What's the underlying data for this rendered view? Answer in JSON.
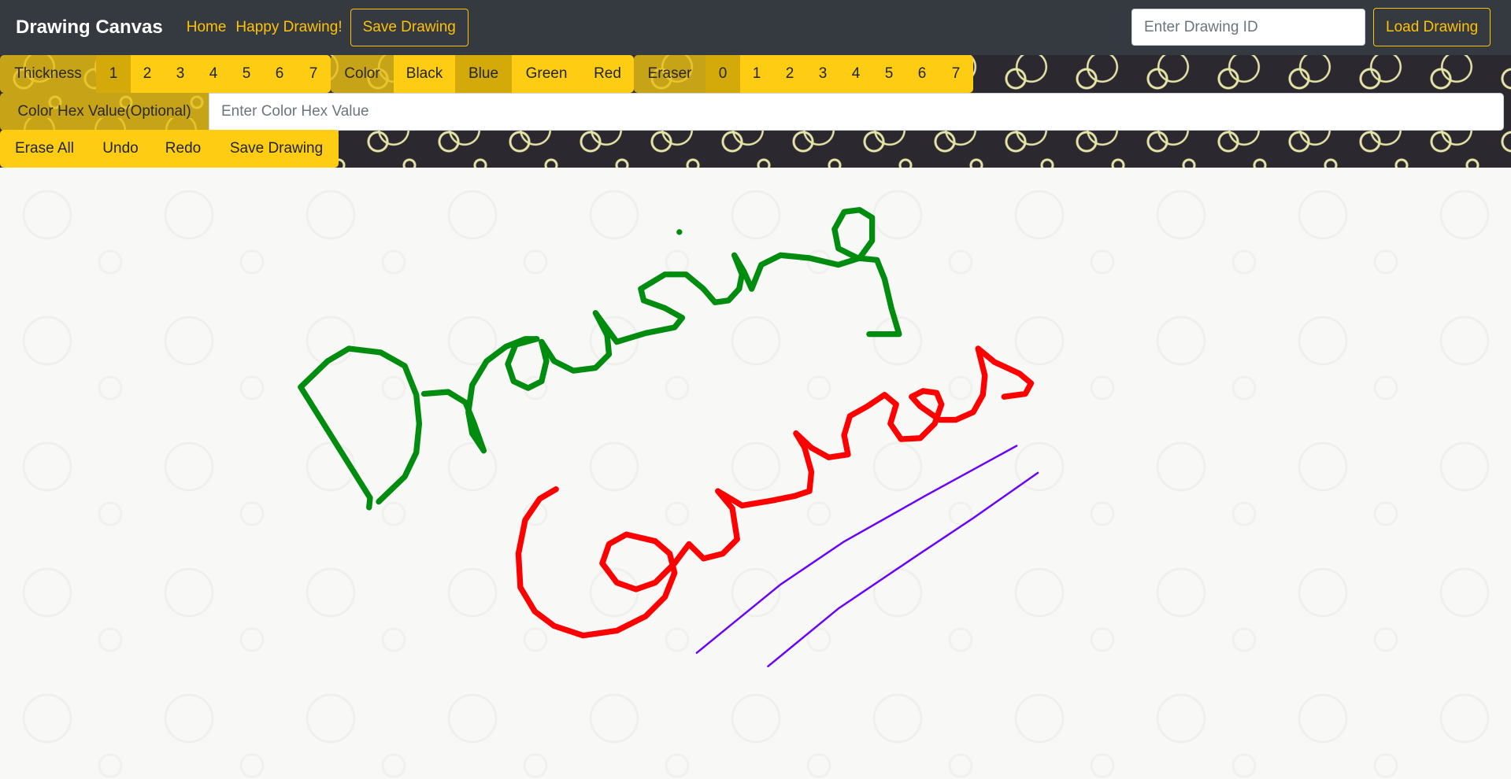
{
  "navbar": {
    "brand": "Drawing Canvas",
    "links": [
      "Home",
      "Happy Drawing!"
    ],
    "save_button": "Save Drawing",
    "drawing_id_placeholder": "Enter Drawing ID",
    "load_button": "Load Drawing"
  },
  "toolbar": {
    "thickness": {
      "label": "Thickness",
      "options": [
        "1",
        "2",
        "3",
        "4",
        "5",
        "6",
        "7"
      ],
      "selected": "1"
    },
    "color": {
      "label": "Color",
      "options": [
        "Black",
        "Blue",
        "Green",
        "Red"
      ],
      "selected": "Blue"
    },
    "eraser": {
      "label": "Eraser",
      "options": [
        "0",
        "1",
        "2",
        "3",
        "4",
        "5",
        "6",
        "7"
      ],
      "selected": "0"
    },
    "hex": {
      "label": "Color Hex Value(Optional)",
      "placeholder": "Enter Color Hex Value",
      "value": ""
    },
    "actions": [
      "Erase All",
      "Undo",
      "Redo",
      "Save Drawing"
    ]
  },
  "colors": {
    "navbar": "#343a40",
    "accent": "#ffc107",
    "button": "#fecd13",
    "active": "#d4aa0b",
    "stroke_green": "#008c0e",
    "stroke_red": "#ff0000",
    "stroke_blue": "#6a00ff"
  }
}
